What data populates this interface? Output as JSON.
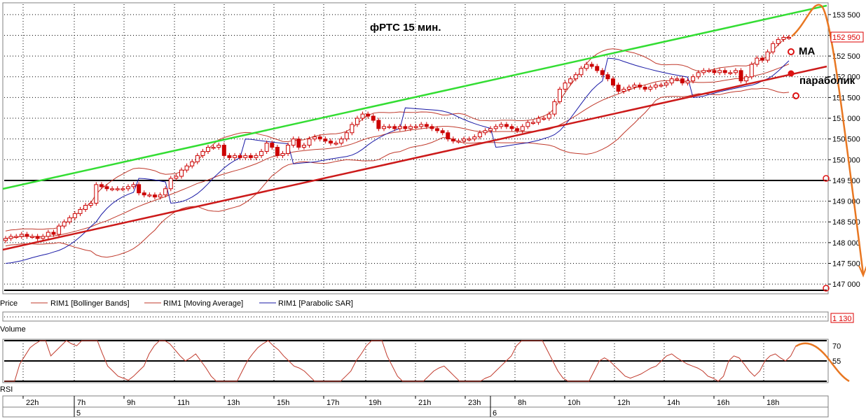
{
  "chart_data": [
    {
      "type": "candlestick",
      "title": "фРТС   15 мин.",
      "y_ticks": [
        153500,
        153000,
        152500,
        152000,
        151500,
        151000,
        150500,
        150000,
        149500,
        149000,
        148500,
        148000,
        147500,
        147000
      ],
      "y_tick_labels": [
        "153 500",
        "153 000",
        "152 500",
        "152 000",
        "151 500",
        "151 000",
        "150 500",
        "150 000",
        "149 500",
        "149 000",
        "148 500",
        "148 000",
        "147 500",
        "147 000"
      ],
      "ylim": [
        146800,
        153750
      ],
      "last_price_label": "152 950",
      "legend": [
        "Price",
        "RIM1 [Bollinger Bands]",
        "RIM1 [Moving Average]",
        "RIM1 [Parabolic SAR]"
      ],
      "annotations": [
        "МА",
        "параболик"
      ],
      "horizontal_levels": [
        149500,
        146850
      ],
      "close": [
        148100,
        148150,
        148150,
        148200,
        148150,
        148150,
        148100,
        148150,
        148250,
        148200,
        148400,
        148500,
        148600,
        148700,
        148800,
        148900,
        148950,
        149400,
        149350,
        149300,
        149300,
        149300,
        149300,
        149350,
        149400,
        149200,
        149150,
        149150,
        149100,
        149150,
        149300,
        149550,
        149600,
        149750,
        149850,
        149950,
        150100,
        150200,
        150300,
        150300,
        150350,
        150100,
        150050,
        150100,
        150050,
        150100,
        150050,
        150100,
        150200,
        150400,
        150300,
        150100,
        150150,
        150350,
        150500,
        150300,
        150350,
        150500,
        150550,
        150500,
        150450,
        150400,
        150400,
        150500,
        150650,
        150850,
        151000,
        151100,
        151050,
        150950,
        150750,
        150800,
        150800,
        150750,
        150800,
        150750,
        150800,
        150800,
        150850,
        150800,
        150750,
        150700,
        150650,
        150500,
        150450,
        150450,
        150500,
        150500,
        150550,
        150650,
        150700,
        150750,
        150800,
        150850,
        150800,
        150750,
        150700,
        150800,
        150900,
        150900,
        151000,
        151000,
        151100,
        151400,
        151700,
        151850,
        151950,
        152050,
        152200,
        152300,
        152250,
        152150,
        152050,
        151950,
        151800,
        151650,
        151700,
        151750,
        151800,
        151750,
        151700,
        151750,
        151800,
        151800,
        151850,
        151950,
        151950,
        151850,
        151900,
        152000,
        152100,
        152150,
        152150,
        152100,
        152150,
        152100,
        152100,
        152150,
        151900,
        152000,
        152300,
        152450,
        152400,
        152600,
        152800,
        152900,
        152950,
        152950
      ]
    },
    {
      "type": "volume",
      "title": "",
      "legend": [
        "Volume"
      ],
      "last_value_label": "1 130"
    },
    {
      "type": "line",
      "title": "",
      "legend": [
        "RSI"
      ],
      "y_ticks": [
        70,
        55
      ],
      "y_tick_labels": [
        "70",
        "55"
      ],
      "ylim": [
        35,
        75
      ],
      "levels": [
        75,
        55,
        35
      ],
      "values": [
        30,
        30,
        30,
        52,
        60,
        68,
        72,
        75,
        78,
        60,
        65,
        70,
        75,
        72,
        70,
        75,
        78,
        80,
        75,
        62,
        50,
        45,
        40,
        38,
        36,
        40,
        45,
        50,
        62,
        70,
        75,
        78,
        72,
        66,
        60,
        55,
        58,
        62,
        55,
        48,
        40,
        35,
        30,
        28,
        30,
        35,
        45,
        55,
        62,
        68,
        72,
        75,
        70,
        66,
        60,
        55,
        50,
        48,
        45,
        40,
        35,
        32,
        30,
        28,
        30,
        35,
        40,
        45,
        55,
        62,
        70,
        75,
        80,
        78,
        60,
        50,
        40,
        30,
        28,
        30,
        32,
        35,
        40,
        45,
        48,
        50,
        45,
        40,
        35,
        32,
        30,
        30,
        35,
        38,
        40,
        45,
        50,
        55,
        60,
        70,
        75,
        80,
        82,
        80,
        75,
        65,
        55,
        45,
        38,
        35,
        30,
        28,
        30,
        35,
        45,
        55,
        58,
        55,
        50,
        45,
        40,
        38,
        40,
        42,
        45,
        48,
        50,
        55,
        60,
        62,
        58,
        55,
        52,
        50,
        48,
        45,
        40,
        38,
        35,
        40,
        55,
        60,
        58,
        52,
        45,
        40,
        45,
        55,
        60,
        62,
        58,
        55,
        60,
        70
      ]
    }
  ],
  "time_axis": {
    "hour_labels": [
      "22h",
      "7h",
      "9h",
      "11h",
      "13h",
      "15h",
      "17h",
      "19h",
      "21h",
      "23h",
      "8h",
      "10h",
      "12h",
      "14h",
      "16h",
      "18h"
    ],
    "day_labels": [
      "5",
      "6"
    ]
  },
  "colors": {
    "candle_up": "#ffffff",
    "candle_down": "#cc0000",
    "candle_outline": "#cc0000",
    "bollinger": "#c0392b",
    "moving_average": "#c0392b",
    "parabolic_sar": "#1a1aa6",
    "support_trend": "#cc1a1a",
    "resistance_trend": "#33dd33",
    "forecast": "#e87722",
    "grid": "#000000",
    "background": "#ffffff"
  }
}
